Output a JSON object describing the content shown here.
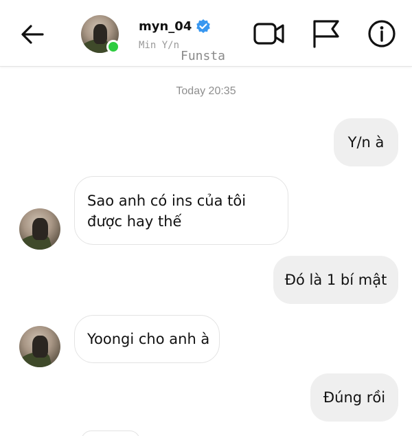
{
  "header": {
    "username": "myn_04",
    "subtitle": "Min Y/n",
    "watermark": "Funsta",
    "online": true,
    "verified": true,
    "online_color": "#2ecc40",
    "verified_color": "#3897f0"
  },
  "icons": {
    "back": "arrow-left-icon",
    "video": "video-camera-icon",
    "flag": "flag-icon",
    "info": "info-icon"
  },
  "conversation": {
    "timestamp": "Today 20:35",
    "messages": [
      {
        "from": "me",
        "text": "Y/n à"
      },
      {
        "from": "them",
        "lines": [
          "Sao anh có ins của tôi",
          "được hay thế"
        ]
      },
      {
        "from": "me",
        "text": "Đó là 1 bí mật"
      },
      {
        "from": "them",
        "text": "Yoongi cho anh à"
      },
      {
        "from": "me",
        "text": "Đúng rồi"
      }
    ]
  }
}
